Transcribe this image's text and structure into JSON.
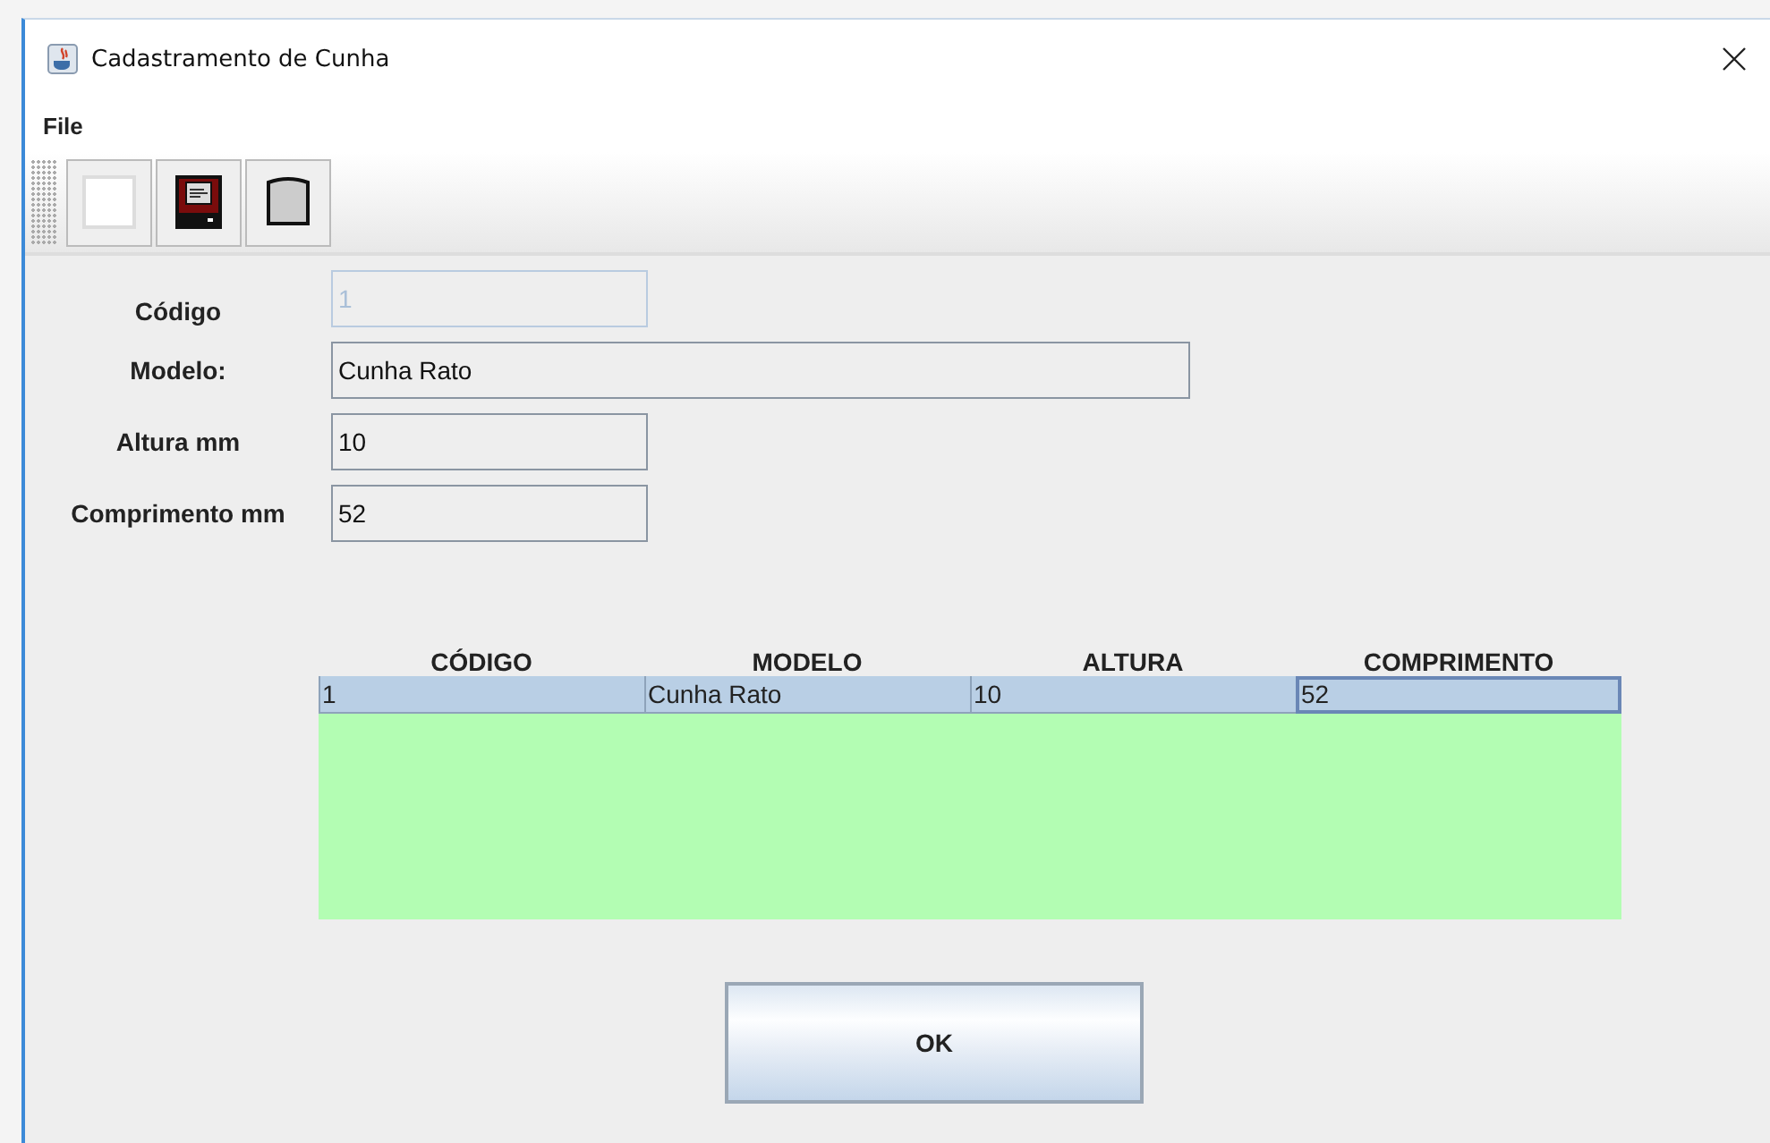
{
  "window": {
    "title": "Cadastramento de Cunha"
  },
  "menu": [
    "File"
  ],
  "toolbar": [
    {
      "kind": "blank"
    },
    {
      "kind": "save"
    },
    {
      "kind": "database"
    }
  ],
  "fields": [
    {
      "label": "Código",
      "value": "1",
      "disabled": true,
      "wide": false
    },
    {
      "label": "Modelo:",
      "value": "Cunha Rato",
      "disabled": false,
      "wide": true
    },
    {
      "label": "Altura mm",
      "value": "10",
      "disabled": false,
      "wide": false
    },
    {
      "label": "Comprimento mm",
      "value": "52",
      "disabled": false,
      "wide": false
    }
  ],
  "table": {
    "columns": [
      "CÓDIGO",
      "MODELO",
      "ALTURA",
      "COMPRIMENTO"
    ],
    "rows": [
      {
        "selected": true,
        "cells": [
          {
            "text": "1",
            "focused": false
          },
          {
            "text": "Cunha Rato",
            "focused": false
          },
          {
            "text": "10",
            "focused": false
          },
          {
            "text": "52",
            "focused": true
          }
        ]
      }
    ]
  },
  "buttons": [
    "OK"
  ]
}
